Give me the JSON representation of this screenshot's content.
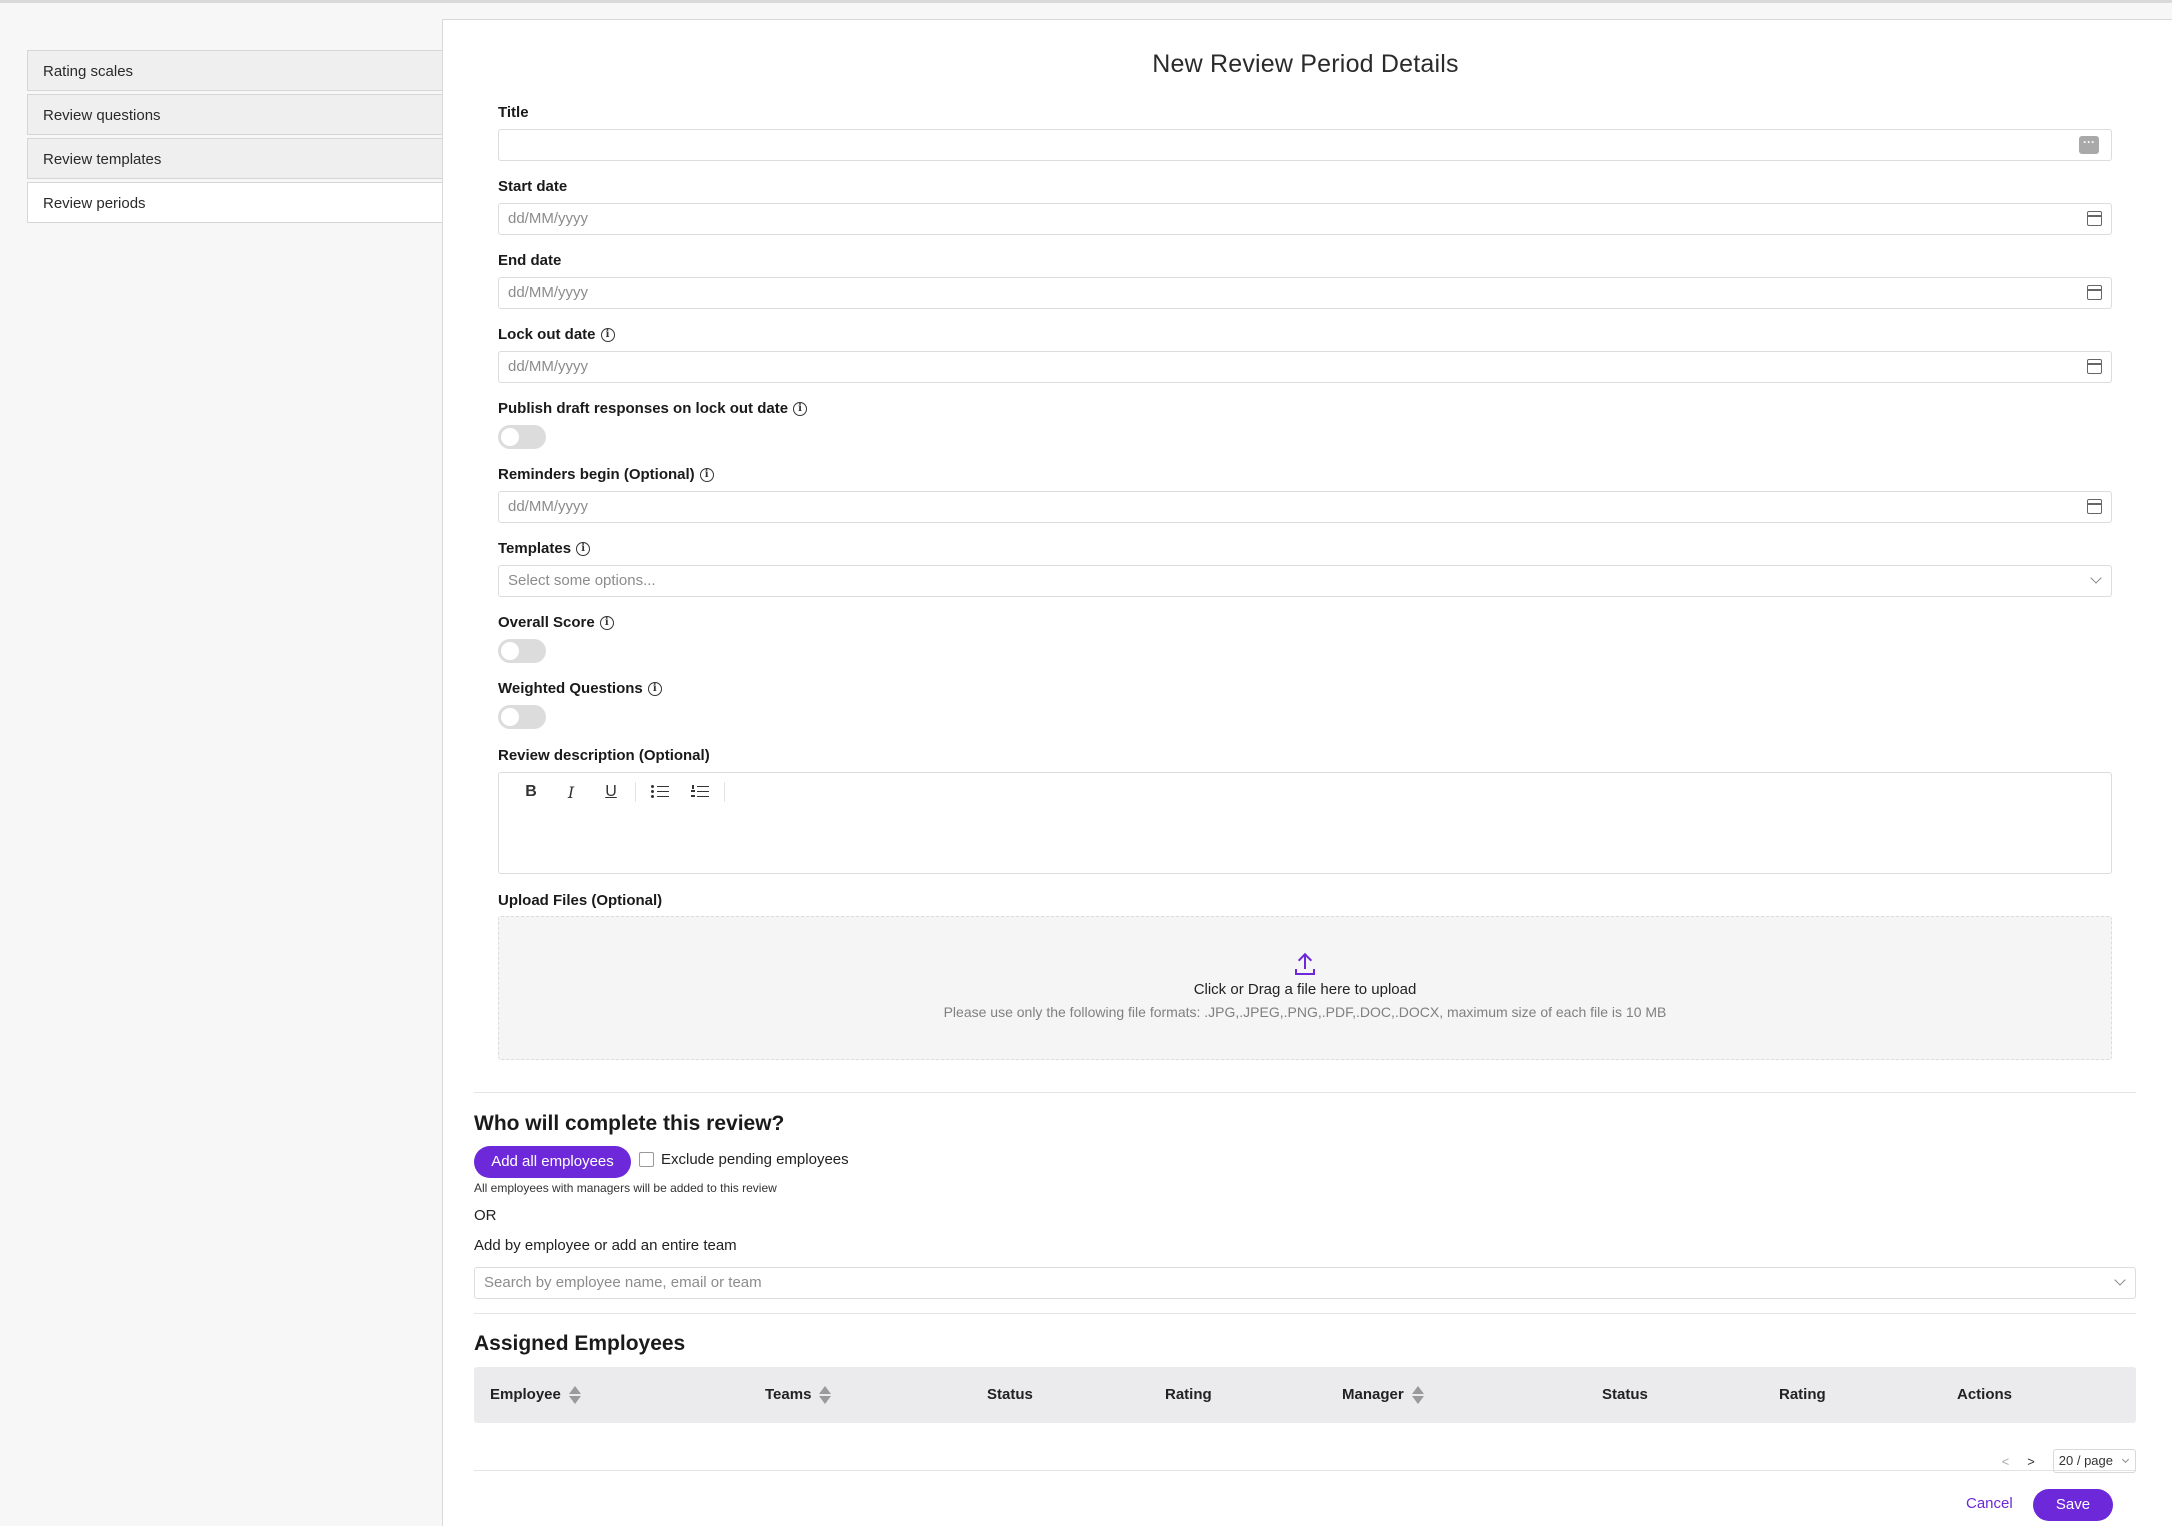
{
  "sidebar": {
    "items": [
      {
        "label": "Rating scales"
      },
      {
        "label": "Review questions"
      },
      {
        "label": "Review templates"
      },
      {
        "label": "Review periods"
      }
    ]
  },
  "form": {
    "heading": "New Review Period Details",
    "title_label": "Title",
    "title_value": "",
    "start_date_label": "Start date",
    "start_date_placeholder": "dd/MM/yyyy",
    "end_date_label": "End date",
    "end_date_placeholder": "dd/MM/yyyy",
    "lockout_label": "Lock out date",
    "lockout_placeholder": "dd/MM/yyyy",
    "publish_label": "Publish draft responses on lock out date",
    "reminders_label": "Reminders begin (Optional)",
    "reminders_placeholder": "dd/MM/yyyy",
    "templates_label": "Templates",
    "templates_placeholder": "Select some options...",
    "overall_label": "Overall Score",
    "weighted_label": "Weighted Questions",
    "description_label": "Review description (Optional)",
    "upload_label": "Upload Files (Optional)",
    "upload_main": "Click or Drag a file here to upload",
    "upload_sub": "Please use only the following file formats: .JPG,.JPEG,.PNG,.PDF,.DOC,.DOCX, maximum size of each file is 10 MB",
    "info_glyph": "i",
    "dots_glyph": "···",
    "toolbar": {
      "bold": "B",
      "italic": "I",
      "underline": "U"
    }
  },
  "completion": {
    "title": "Who will complete this review?",
    "add_all_button": "Add all employees",
    "exclude_label": "Exclude pending employees",
    "note": "All employees with managers will be added to this review",
    "or_text": "OR",
    "add_by_text": "Add by employee or add an entire team",
    "search_placeholder": "Search by employee name, email or team"
  },
  "assigned": {
    "title": "Assigned Employees",
    "columns": [
      "Employee",
      "Teams",
      "Status",
      "Rating",
      "Manager",
      "Status",
      "Rating",
      "Actions"
    ]
  },
  "pagination": {
    "prev": "<",
    "next": ">",
    "page_size": "20 / page"
  },
  "footer": {
    "cancel": "Cancel",
    "save": "Save"
  },
  "colors": {
    "accent": "#6d28d9"
  }
}
